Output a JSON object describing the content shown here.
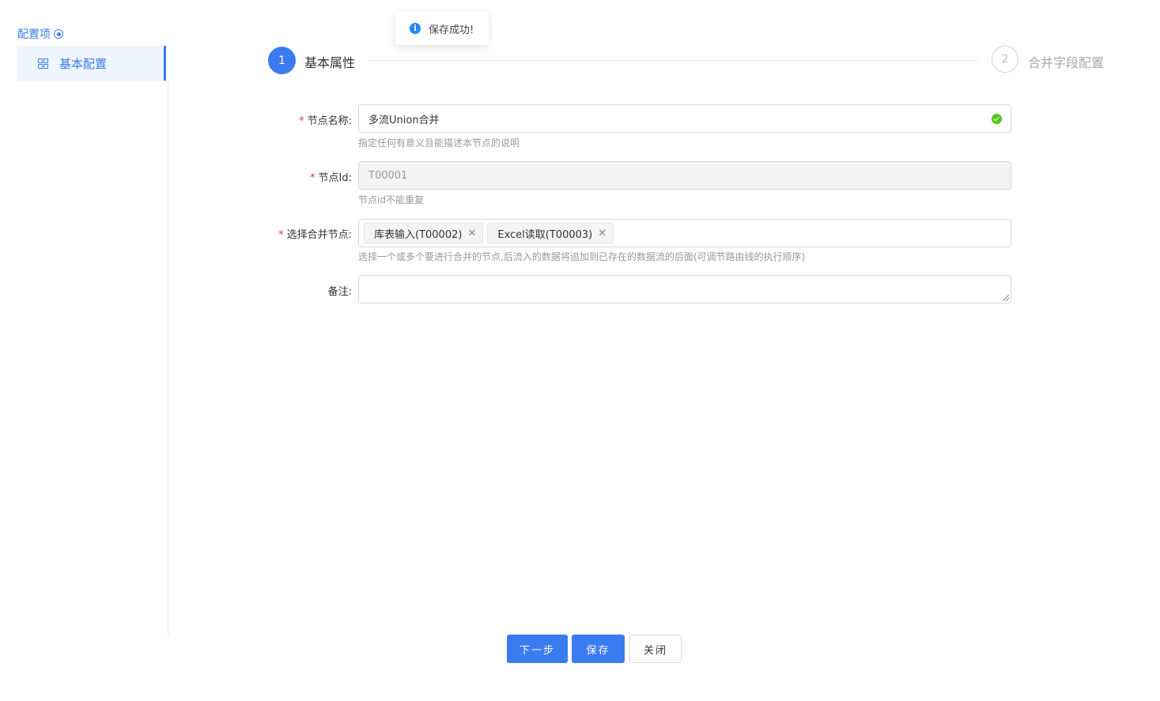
{
  "sidebar": {
    "title": "配置项",
    "items": [
      {
        "label": "基本配置",
        "icon": "grid-icon",
        "active": true
      }
    ]
  },
  "toast": {
    "icon": "info-icon",
    "text": "保存成功!"
  },
  "steps": [
    {
      "number": "1",
      "label": "基本属性",
      "active": true
    },
    {
      "number": "2",
      "label": "合并字段配置",
      "active": false
    }
  ],
  "form": {
    "node_name": {
      "label": "节点名称:",
      "value": "多流Union合并",
      "help": "指定任何有意义且能描述本节点的说明",
      "required": true
    },
    "node_id": {
      "label": "节点Id:",
      "value": "T00001",
      "help": "节点id不能重复",
      "required": true
    },
    "merge_nodes": {
      "label": "选择合并节点:",
      "tags": [
        "库表输入(T00002)",
        "Excel读取(T00003)"
      ],
      "help": "选择一个或多个要进行合并的节点,后流入的数据将追加到已存在的数据流的后面(可调节路由线的执行顺序)",
      "required": true
    },
    "remark": {
      "label": "备注:",
      "value": "",
      "required": false
    }
  },
  "buttons": {
    "next": "下一步",
    "save": "保存",
    "close": "关闭"
  },
  "colors": {
    "primary": "#3a7bf0",
    "success": "#52c41a",
    "required": "#e4393c"
  }
}
